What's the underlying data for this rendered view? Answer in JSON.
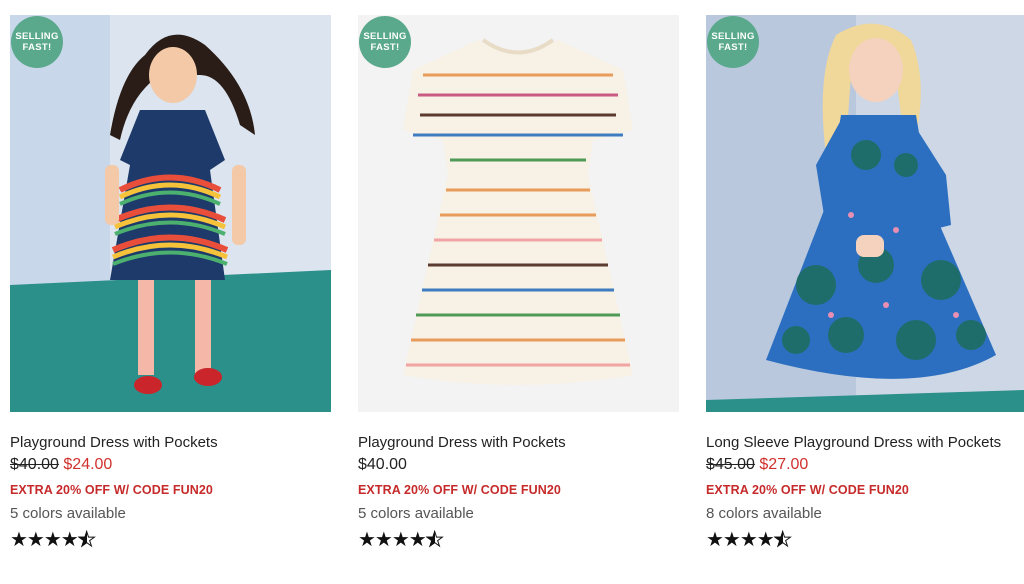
{
  "products": [
    {
      "badge": "SELLING FAST!",
      "title": "Playground Dress with Pockets",
      "price_old": "$40.00",
      "price_sale": "$24.00",
      "promo": "EXTRA 20% OFF W/ CODE FUN20",
      "colors": "5 colors available",
      "rating": 4.5,
      "stars": "★★★★"
    },
    {
      "badge": "SELLING FAST!",
      "title": "Playground Dress with Pockets",
      "price": "$40.00",
      "promo": "EXTRA 20% OFF W/ CODE FUN20",
      "colors": "5 colors available",
      "rating": 4.5,
      "stars": "★★★★"
    },
    {
      "badge": "SELLING FAST!",
      "title": "Long Sleeve Playground Dress with Pockets",
      "price_old": "$45.00",
      "price_sale": "$27.00",
      "promo": "EXTRA 20% OFF W/ CODE FUN20",
      "colors": "8 colors available",
      "rating": 4.5,
      "stars": "★★★★"
    }
  ],
  "colors": {
    "badge_bg": "#5aa98c",
    "sale_price": "#d0312d",
    "promo": "#c62a2a"
  }
}
